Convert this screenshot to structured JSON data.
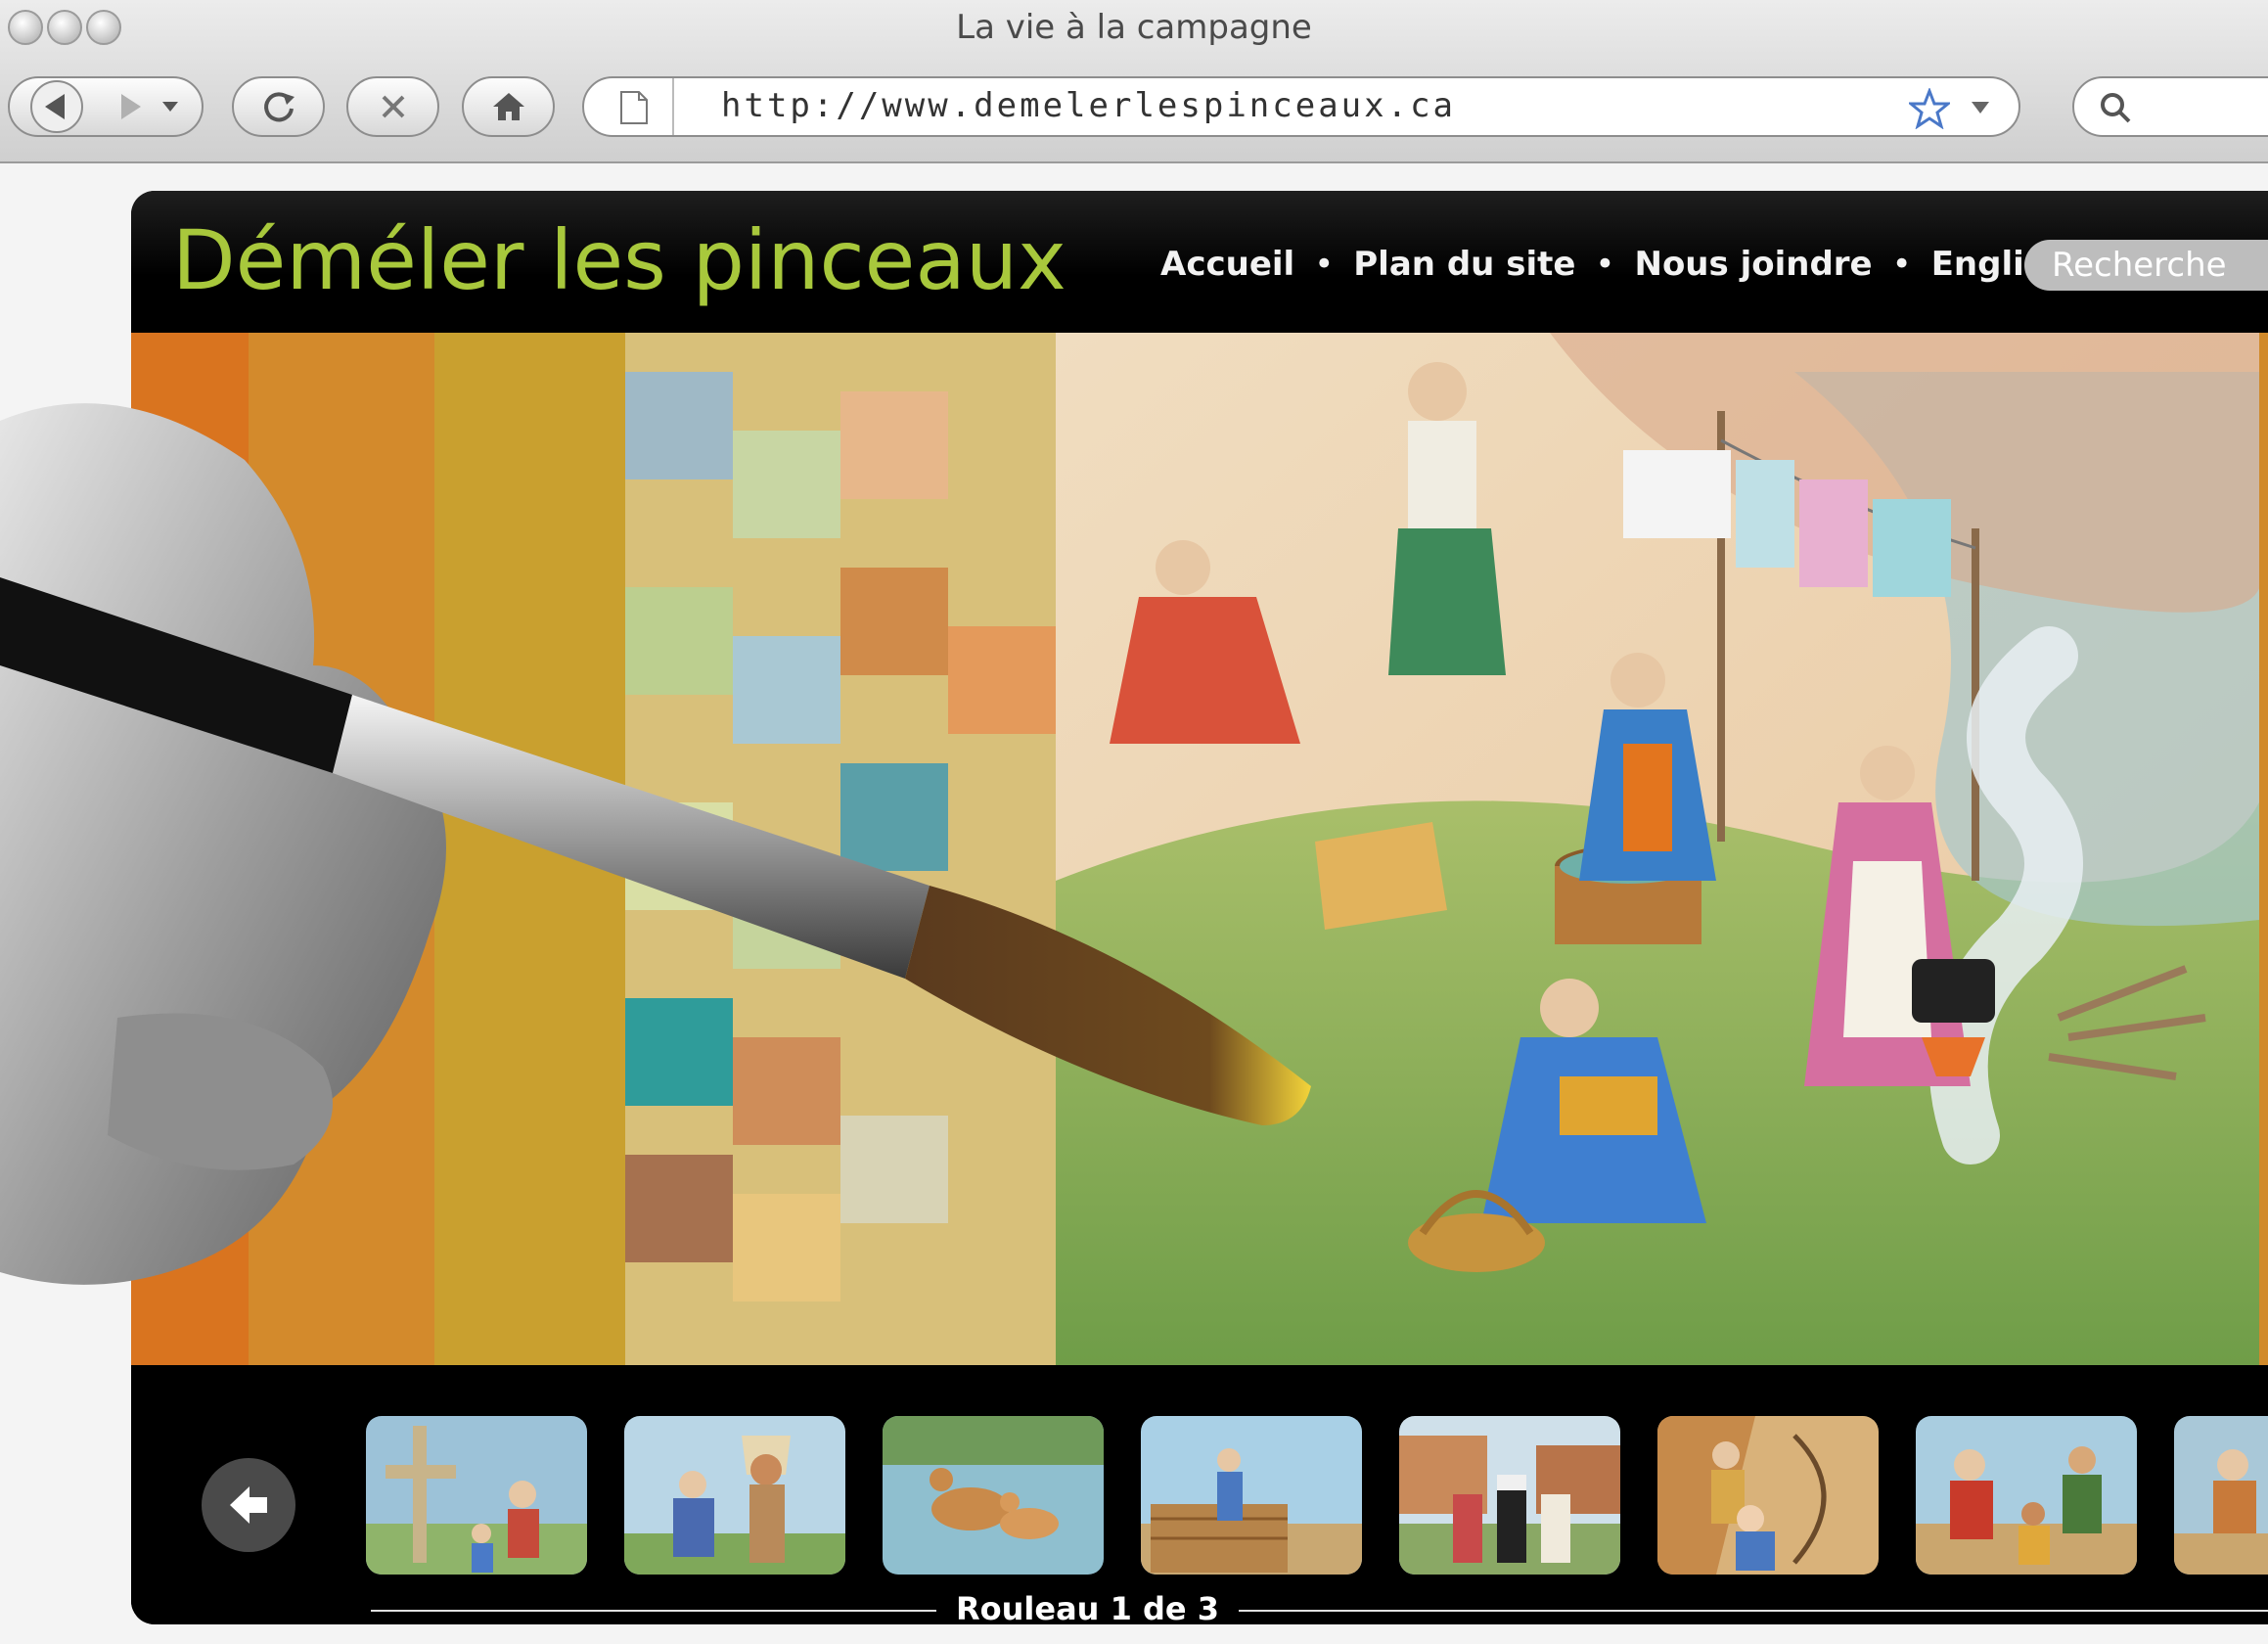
{
  "browser": {
    "window_title": "La vie à la campagne",
    "url": "http://www.demelerlespinceaux.ca"
  },
  "site": {
    "logo": "Déméler les pinceaux",
    "nav": [
      {
        "label": "Accueil"
      },
      {
        "label": "Plan du site"
      },
      {
        "label": "Nous joindre"
      },
      {
        "label": "English"
      }
    ],
    "search_label": "Recherche",
    "accent_color": "#a8c83c"
  },
  "carousel": {
    "pager_label": "Rouleau 1 de 3",
    "thumbnails": [
      {
        "subject": "cross"
      },
      {
        "subject": "indigenous-chief"
      },
      {
        "subject": "deer"
      },
      {
        "subject": "log-builder"
      },
      {
        "subject": "village-priest"
      },
      {
        "subject": "archer"
      },
      {
        "subject": "traders"
      },
      {
        "subject": "partial"
      }
    ]
  }
}
